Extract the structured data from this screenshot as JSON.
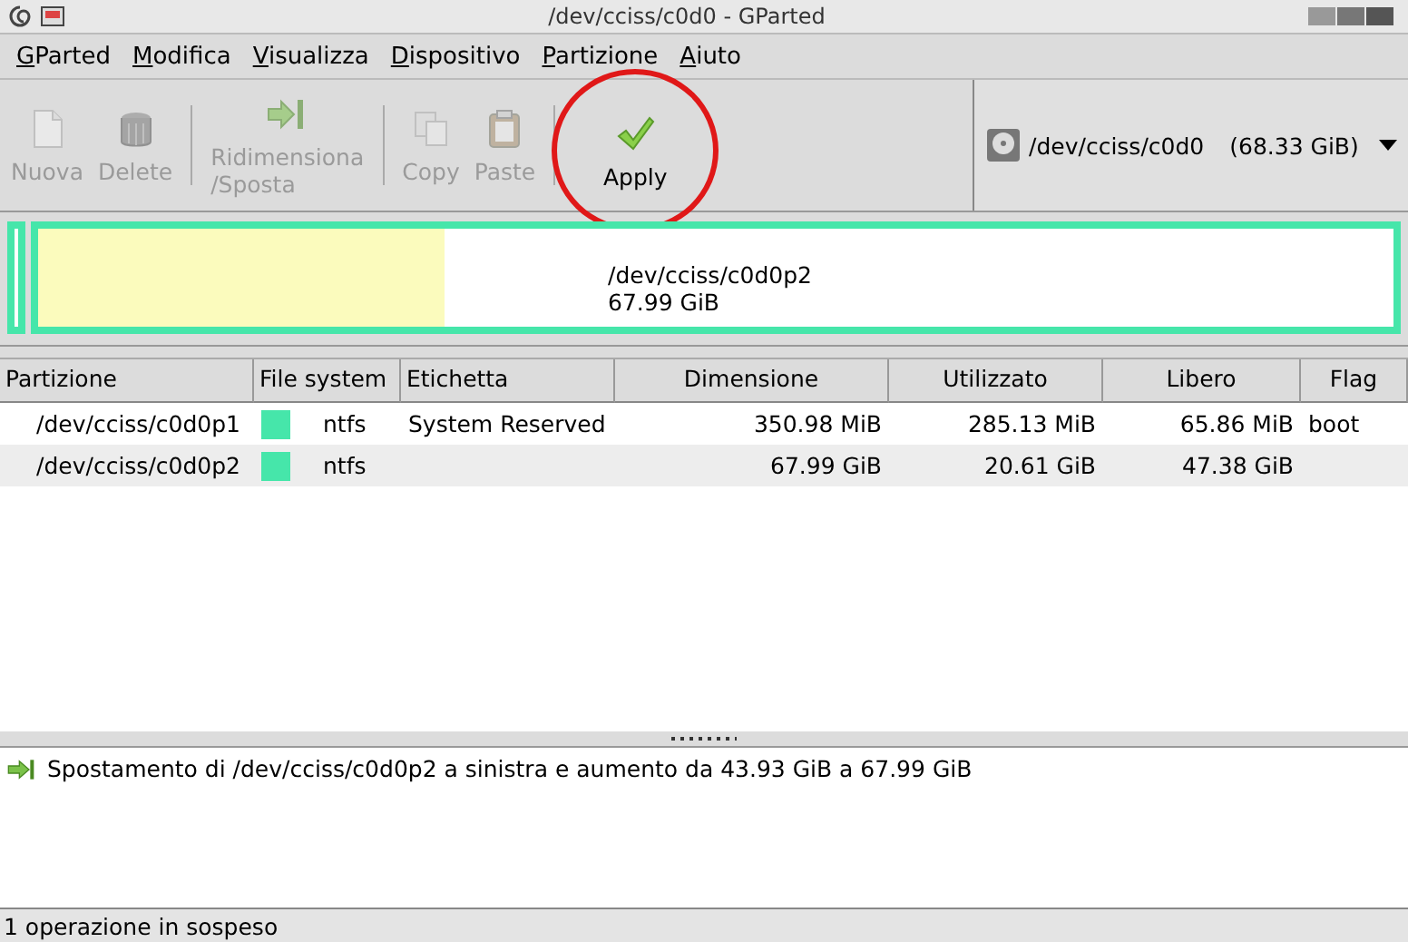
{
  "window": {
    "title": "/dev/cciss/c0d0 - GParted"
  },
  "menu": [
    "GParted",
    "Modifica",
    "Visualizza",
    "Dispositivo",
    "Partizione",
    "Aiuto"
  ],
  "toolbar": [
    {
      "kind": "new",
      "label": "Nuova",
      "disabled": true
    },
    {
      "kind": "delete",
      "label": "Delete",
      "disabled": true
    },
    {
      "kind": "resize",
      "label": "Ridimensiona\n/Sposta",
      "disabled": true
    },
    {
      "kind": "copy",
      "label": "Copy",
      "disabled": true
    },
    {
      "kind": "paste",
      "label": "Paste",
      "disabled": true
    },
    {
      "kind": "apply",
      "label": "Apply",
      "disabled": false,
      "highlighted": true
    }
  ],
  "device": {
    "path": "/dev/cciss/c0d0",
    "size": "(68.33 GiB)"
  },
  "disk_map": {
    "partitions": [
      {
        "kind": "small",
        "color": "#46e6aa"
      },
      {
        "kind": "main",
        "color": "#46e6aa",
        "level": 0.3,
        "path": "/dev/cciss/c0d0p2",
        "size": "67.99 GiB"
      }
    ]
  },
  "table": {
    "columns": [
      "Partizione",
      "File system",
      "Etichetta",
      "Dimensione",
      "Utilizzato",
      "Libero",
      "Flag"
    ],
    "rows": [
      {
        "partition": "/dev/cciss/c0d0p1",
        "color": "#46e6aa",
        "file_system": "ntfs",
        "label": "System Reserved",
        "size": "350.98 MiB",
        "used": "285.13 MiB",
        "free": "65.86 MiB",
        "flag": "boot"
      },
      {
        "partition": "/dev/cciss/c0d0p2",
        "color": "#46e6aa",
        "file_system": "ntfs",
        "size": "67.99 GiB",
        "used": "20.61 GiB",
        "free": "47.38 GiB"
      }
    ]
  },
  "operations": [
    "Spostamento di /dev/cciss/c0d0p2 a sinistra e aumento da 43.93 GiB a 67.99 GiB"
  ],
  "status_bar": "1 operazione in sospeso"
}
